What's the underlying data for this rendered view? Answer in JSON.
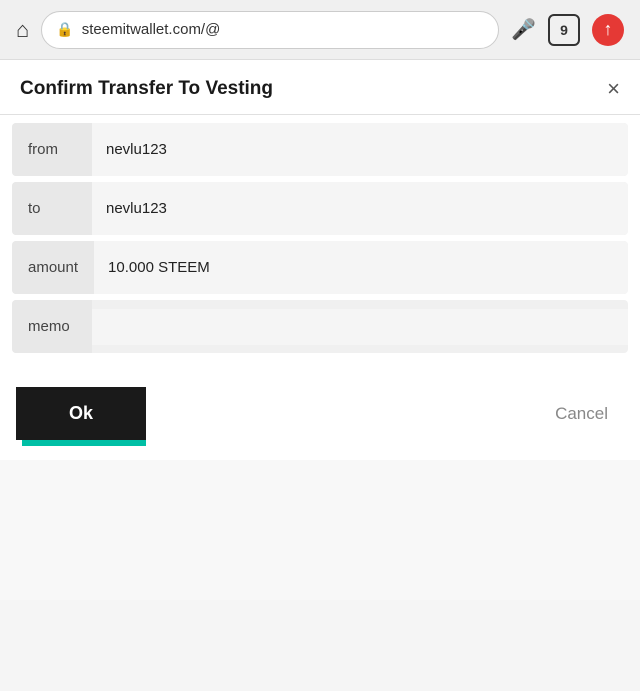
{
  "browser": {
    "address": "steemitwallet.com/@",
    "tab_count": "9"
  },
  "dialog": {
    "title": "Confirm Transfer To Vesting",
    "close_label": "×",
    "fields": [
      {
        "label": "from",
        "value": "nevlu123"
      },
      {
        "label": "to",
        "value": "nevlu123"
      },
      {
        "label": "amount",
        "value": "10.000 STEEM"
      },
      {
        "label": "memo",
        "value": ""
      }
    ],
    "ok_label": "Ok",
    "cancel_label": "Cancel"
  }
}
